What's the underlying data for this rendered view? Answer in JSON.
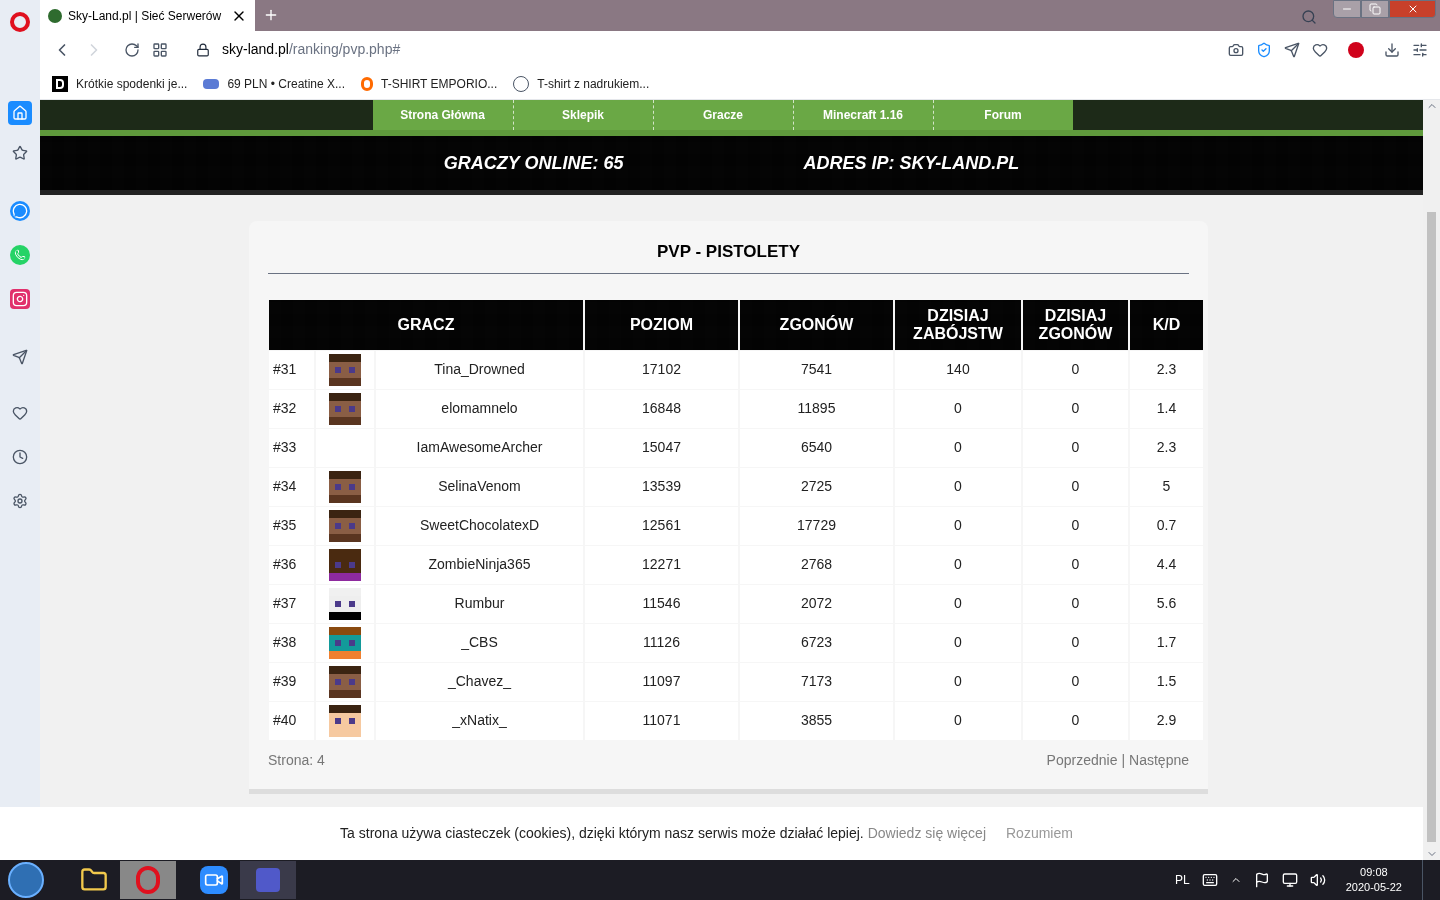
{
  "browser": {
    "tab_title": "Sky-Land.pl | Sieć Serwerów",
    "url_host": "sky-land.pl",
    "url_path": "/ranking/pvp.php#",
    "bookmarks": [
      {
        "kind": "d",
        "label": "Krótkie spodenki je..."
      },
      {
        "kind": "shop",
        "label": "69 PLN • Creatine X..."
      },
      {
        "kind": "a",
        "label": "T-SHIRT EMPORIO..."
      },
      {
        "kind": "circle",
        "label": "T-shirt z nadrukiem..."
      }
    ]
  },
  "nav": [
    "Strona Główna",
    "Sklepik",
    "Gracze",
    "Minecraft 1.16",
    "Forum"
  ],
  "info_bar": [
    "GRACZY ONLINE: 65",
    "ADRES IP: SKY-LAND.PL"
  ],
  "ranking": {
    "title": "PVP - PISTOLETY",
    "columns": [
      "GRACZ",
      "POZIOM",
      "ZGONÓW",
      "DZISIAJ ZABÓJSTW",
      "DZISIAJ ZGONÓW",
      "K/D"
    ],
    "rows": [
      {
        "rank": "#31",
        "avatar": {
          "kind": "brown"
        },
        "name": "Tina_Drowned",
        "level": "17102",
        "deaths": "7541",
        "kills_today": "140",
        "deaths_today": "0",
        "kd": "2.3"
      },
      {
        "rank": "#32",
        "avatar": {
          "kind": "brown"
        },
        "name": "elomamnelo",
        "level": "16848",
        "deaths": "11895",
        "kills_today": "0",
        "deaths_today": "0",
        "kd": "1.4"
      },
      {
        "rank": "#33",
        "avatar": {
          "kind": "none"
        },
        "name": "IamAwesomeArcher",
        "level": "15047",
        "deaths": "6540",
        "kills_today": "0",
        "deaths_today": "0",
        "kd": "2.3"
      },
      {
        "rank": "#34",
        "avatar": {
          "kind": "brown"
        },
        "name": "SelinaVenom",
        "level": "13539",
        "deaths": "2725",
        "kills_today": "0",
        "deaths_today": "0",
        "kd": "5"
      },
      {
        "rank": "#35",
        "avatar": {
          "kind": "brown"
        },
        "name": "SweetChocolatexD",
        "level": "12561",
        "deaths": "17729",
        "kills_today": "0",
        "deaths_today": "0",
        "kd": "0.7"
      },
      {
        "rank": "#36",
        "avatar": {
          "kind": "ninja"
        },
        "name": "ZombieNinja365",
        "level": "12271",
        "deaths": "2768",
        "kills_today": "0",
        "deaths_today": "0",
        "kd": "4.4"
      },
      {
        "rank": "#37",
        "avatar": {
          "kind": "white"
        },
        "name": "Rumbur",
        "level": "11546",
        "deaths": "2072",
        "kills_today": "0",
        "deaths_today": "0",
        "kd": "5.6"
      },
      {
        "rank": "#38",
        "avatar": {
          "kind": "teal"
        },
        "name": "_CBS",
        "level": "11126",
        "deaths": "6723",
        "kills_today": "0",
        "deaths_today": "0",
        "kd": "1.7"
      },
      {
        "rank": "#39",
        "avatar": {
          "kind": "brown"
        },
        "name": "_Chavez_",
        "level": "11097",
        "deaths": "7173",
        "kills_today": "0",
        "deaths_today": "0",
        "kd": "1.5"
      },
      {
        "rank": "#40",
        "avatar": {
          "kind": "light"
        },
        "name": "_xNatix_",
        "level": "11071",
        "deaths": "3855",
        "kills_today": "0",
        "deaths_today": "0",
        "kd": "2.9"
      }
    ],
    "page": "Strona: 4",
    "prev": "Poprzednie",
    "separator": "|",
    "next": "Następne"
  },
  "cookie": {
    "text": "Ta strona używa ciasteczek (cookies), dzięki którym nasz serwis może działać lepiej.",
    "link": "Dowiedz się więcej",
    "button": "Rozumiem"
  },
  "taskbar": {
    "language": "PL",
    "time": "09:08",
    "date": "2020-05-22"
  }
}
